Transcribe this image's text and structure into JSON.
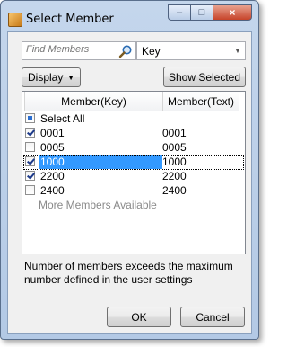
{
  "window": {
    "title": "Select Member",
    "icon": "app-icon",
    "controls": {
      "minimize": "–",
      "maximize": "□",
      "close": "×"
    }
  },
  "search": {
    "placeholder": "Find Members",
    "icon": "search-icon"
  },
  "field_selector": {
    "value": "Key"
  },
  "toolbar": {
    "display_label": "Display",
    "show_selected_label": "Show Selected"
  },
  "grid": {
    "columns": [
      "Member(Key)",
      "Member(Text)"
    ],
    "select_all_label": "Select All",
    "rows": [
      {
        "key": "0001",
        "text": "0001",
        "checked": true,
        "selected": false
      },
      {
        "key": "0005",
        "text": "0005",
        "checked": false,
        "selected": false
      },
      {
        "key": "1000",
        "text": "1000",
        "checked": true,
        "selected": true
      },
      {
        "key": "2200",
        "text": "2200",
        "checked": true,
        "selected": false
      },
      {
        "key": "2400",
        "text": "2400",
        "checked": false,
        "selected": false
      }
    ],
    "more_label": "More Members Available"
  },
  "message": {
    "line1": "Number of members exceeds the maximum",
    "line2": "number defined in the user settings"
  },
  "buttons": {
    "ok": "OK",
    "cancel": "Cancel"
  },
  "colors": {
    "selection": "#3399ff",
    "title_bar": "#c4d6ec",
    "close_button": "#c7442a"
  }
}
